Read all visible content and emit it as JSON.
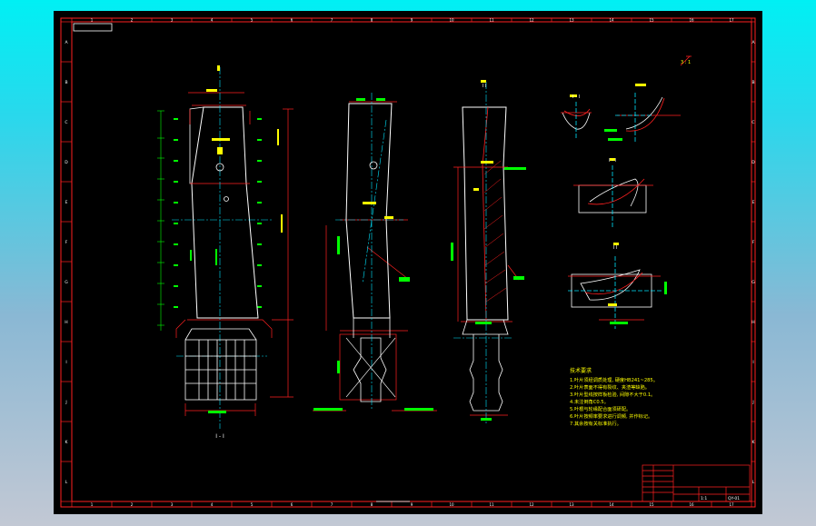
{
  "sheet": {
    "column_labels": [
      "1",
      "2",
      "3",
      "4",
      "5",
      "6",
      "7",
      "8",
      "9",
      "10",
      "11",
      "12",
      "13",
      "14",
      "15",
      "16",
      "17"
    ],
    "row_labels": [
      "A",
      "B",
      "C",
      "D",
      "E",
      "F",
      "G",
      "H",
      "I",
      "J",
      "K",
      "L"
    ]
  },
  "views": {
    "front_view_label": "I - I",
    "blade_view_label": "I I",
    "section_a_label": "I - I",
    "section_b_label": "I - I",
    "section_c_label": "I I",
    "detail_label": "3 : 1"
  },
  "notes": {
    "heading": "技术要求",
    "lines": [
      "1.叶片须经调质处理, 硬度HB241~285。",
      "2.叶片表面不得有裂纹、夹渣等缺陷。",
      "3.叶片型线按样板检验, 间隙不大于0.1。",
      "4.未注倒角C0.5。",
      "5.叶根与轮缘配合面须研配。",
      "6.叶片按频率要求进行调频, 并作标记。",
      "7.其余按有关标准执行。"
    ]
  },
  "title_block": {
    "scale": "1:1",
    "drawing_number": "QY-01"
  },
  "colors": {
    "frame": "#ff2020",
    "outline": "#ffffff",
    "center_line": "#00e5ff",
    "dimension": "#00ff00",
    "text": "#ffff00"
  }
}
